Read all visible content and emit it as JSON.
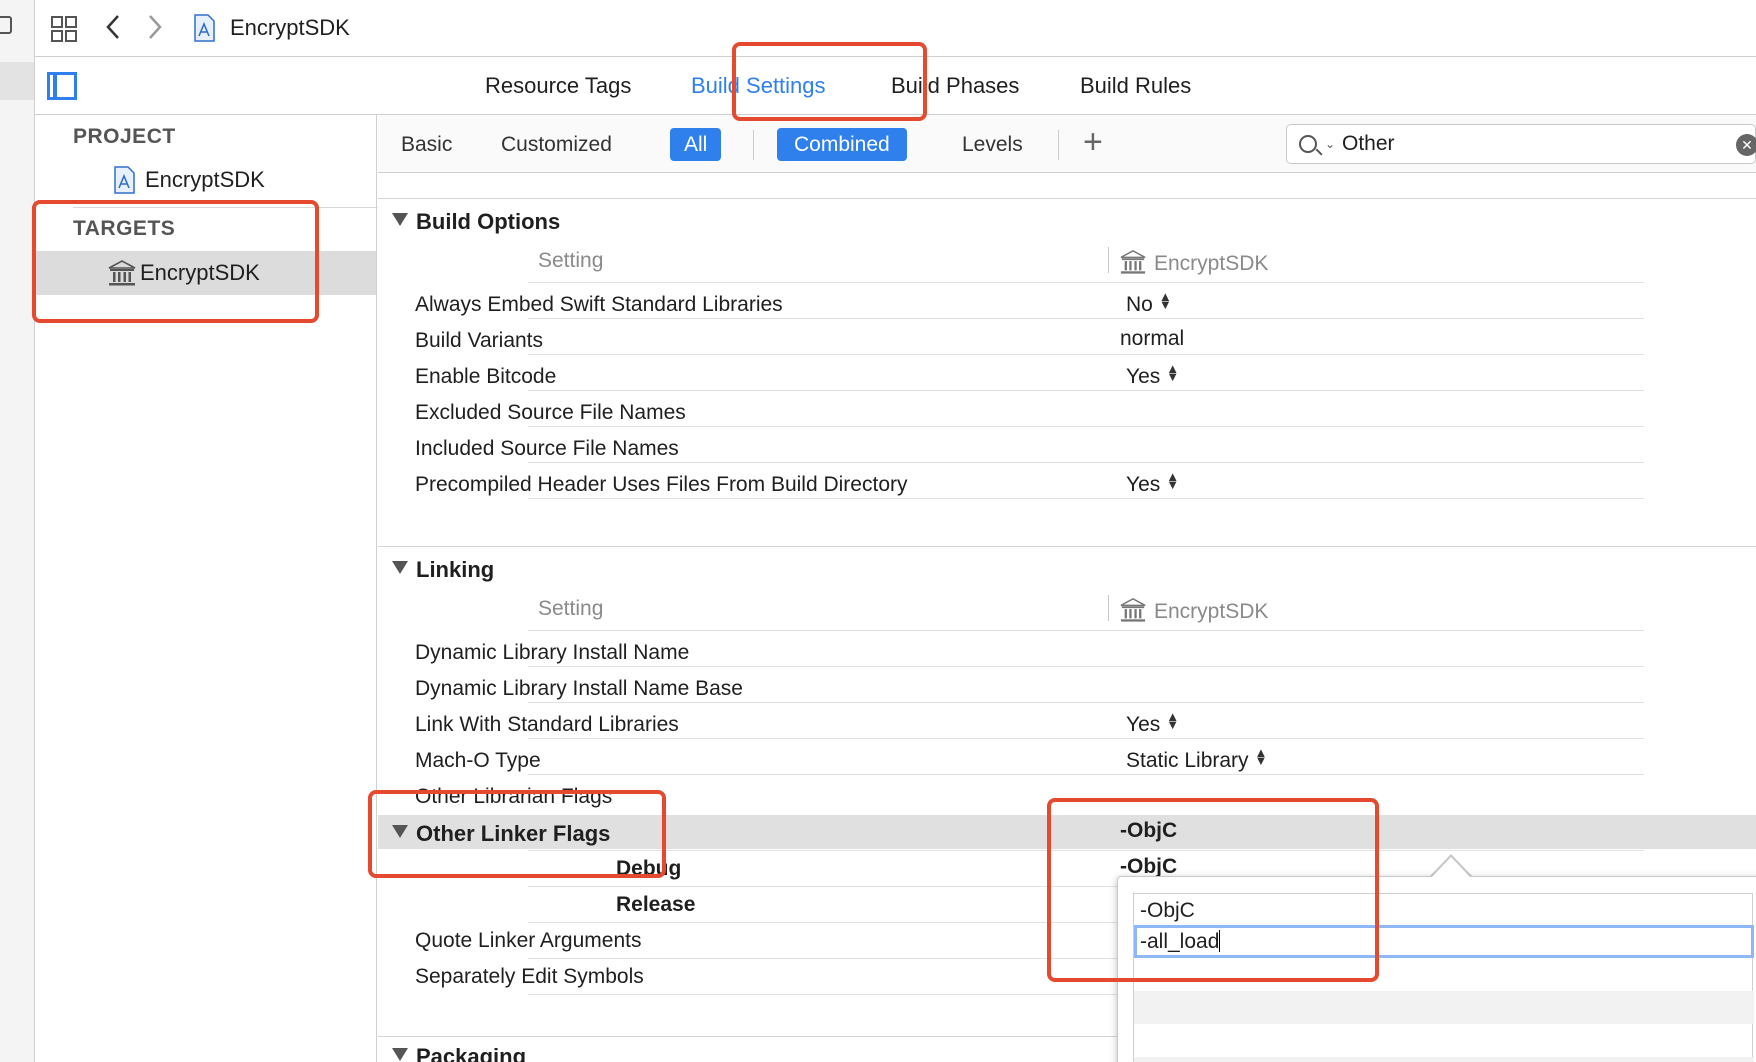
{
  "jumpbar": {
    "crumb": "EncryptSDK"
  },
  "editor_tabs": [
    {
      "label": "Resource Tags",
      "active": false
    },
    {
      "label": "Build Settings",
      "active": true
    },
    {
      "label": "Build Phases",
      "active": false
    },
    {
      "label": "Build Rules",
      "active": false
    }
  ],
  "sidebar": {
    "project_header": "PROJECT",
    "project_item": "EncryptSDK",
    "targets_header": "TARGETS",
    "target_item": "EncryptSDK"
  },
  "filter": {
    "tabs": [
      "Basic",
      "Customized",
      "All",
      "Combined",
      "Levels"
    ],
    "active": [
      "All",
      "Combined"
    ],
    "search_value": "Other"
  },
  "build_options": {
    "title": "Build Options",
    "col_setting": "Setting",
    "col_target": "EncryptSDK",
    "rows": [
      {
        "name": "Always Embed Swift Standard Libraries",
        "value": "No",
        "stepper": true
      },
      {
        "name": "Build Variants",
        "value": "normal",
        "stepper": false
      },
      {
        "name": "Enable Bitcode",
        "value": "Yes",
        "stepper": true
      },
      {
        "name": "Excluded Source File Names",
        "value": "",
        "stepper": false
      },
      {
        "name": "Included Source File Names",
        "value": "",
        "stepper": false
      },
      {
        "name": "Precompiled Header Uses Files From Build Directory",
        "value": "Yes",
        "stepper": true
      }
    ]
  },
  "linking": {
    "title": "Linking",
    "col_setting": "Setting",
    "col_target": "EncryptSDK",
    "rows": [
      {
        "name": "Dynamic Library Install Name",
        "value": "",
        "stepper": false
      },
      {
        "name": "Dynamic Library Install Name Base",
        "value": "",
        "stepper": false
      },
      {
        "name": "Link With Standard Libraries",
        "value": "Yes",
        "stepper": true
      },
      {
        "name": "Mach-O Type",
        "value": "Static Library",
        "stepper": true
      },
      {
        "name": "Other Librarian Flags",
        "value": "",
        "stepper": false
      }
    ],
    "other_linker_flags": {
      "name": "Other Linker Flags",
      "value": "-ObjC",
      "debug_label": "Debug",
      "debug_value": "-ObjC",
      "release_label": "Release"
    },
    "after_rows": [
      {
        "name": "Quote Linker Arguments"
      },
      {
        "name": "Separately Edit Symbols"
      }
    ]
  },
  "packaging": {
    "title": "Packaging"
  },
  "popover": {
    "entries": [
      "-ObjC",
      "-all_load"
    ]
  },
  "colors": {
    "accent": "#2f80ed",
    "annotation": "#e5492f"
  }
}
